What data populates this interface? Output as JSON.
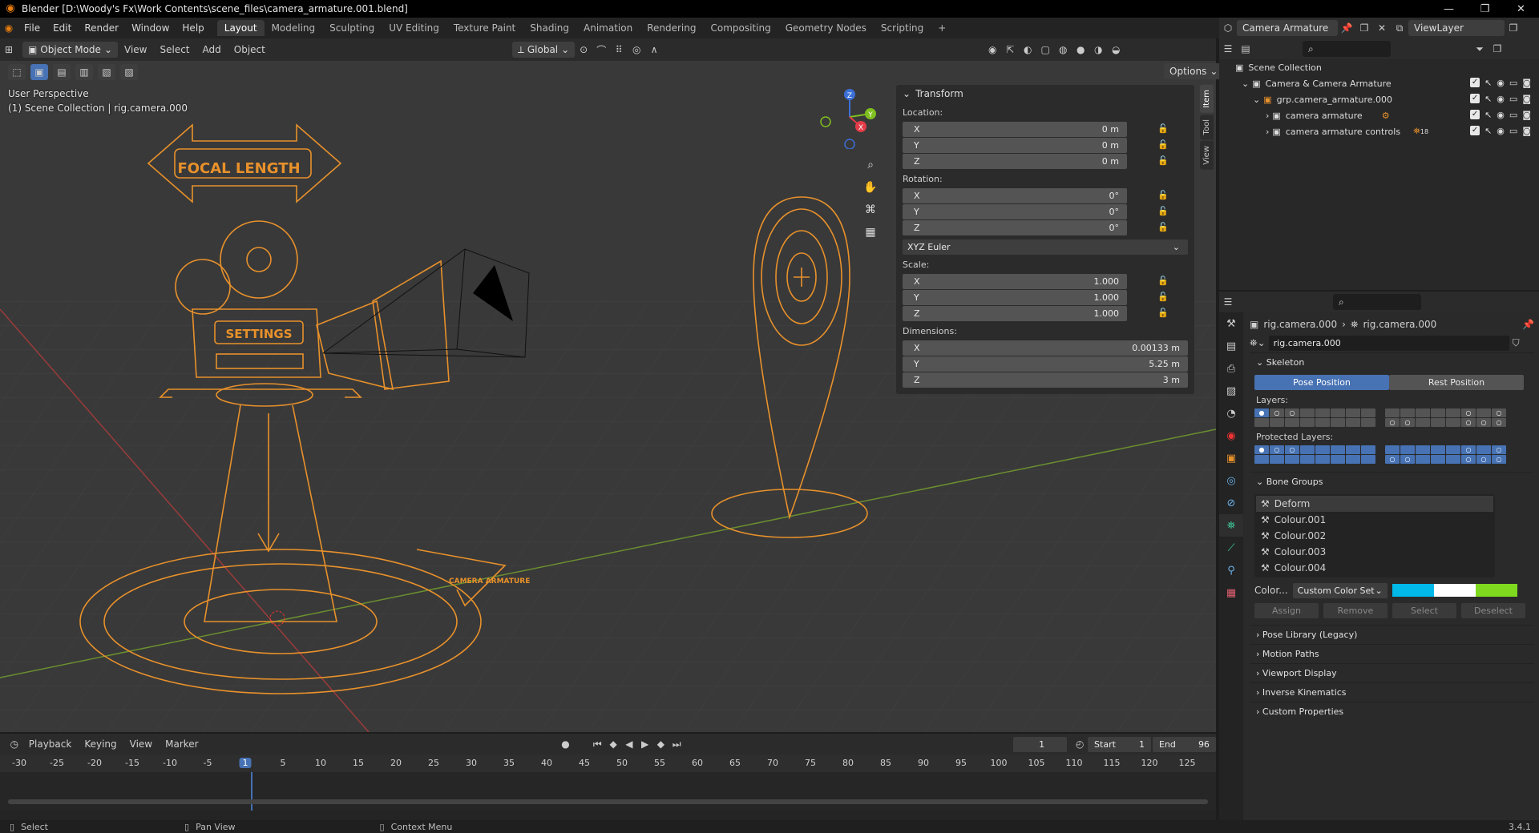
{
  "window": {
    "title": "Blender [D:\\Woody's Fx\\Work Contents\\scene_files\\camera_armature.001.blend]",
    "controls": [
      "—",
      "❐",
      "✕"
    ]
  },
  "menu": [
    "File",
    "Edit",
    "Render",
    "Window",
    "Help"
  ],
  "workspaces": [
    "Layout",
    "Modeling",
    "Sculpting",
    "UV Editing",
    "Texture Paint",
    "Shading",
    "Animation",
    "Rendering",
    "Compositing",
    "Geometry Nodes",
    "Scripting"
  ],
  "active_workspace": "Layout",
  "top_right": {
    "scene_name": "Camera Armature",
    "view_layer": "ViewLayer"
  },
  "viewport_header": {
    "mode": "Object Mode",
    "menus": [
      "View",
      "Select",
      "Add",
      "Object"
    ],
    "orientation": "Global",
    "options": "Options"
  },
  "viewport_overlay_text": {
    "line1": "User Perspective",
    "line2": "(1) Scene Collection | rig.camera.000"
  },
  "gizmo_labels": {
    "z": "Z",
    "y": "Y",
    "x": "X"
  },
  "npanel": {
    "tabs": [
      "Item",
      "Tool",
      "View"
    ],
    "title": "Transform",
    "location_label": "Location:",
    "location": [
      {
        "axis": "X",
        "value": "0 m"
      },
      {
        "axis": "Y",
        "value": "0 m"
      },
      {
        "axis": "Z",
        "value": "0 m"
      }
    ],
    "rotation_label": "Rotation:",
    "rotation": [
      {
        "axis": "X",
        "value": "0°"
      },
      {
        "axis": "Y",
        "value": "0°"
      },
      {
        "axis": "Z",
        "value": "0°"
      }
    ],
    "rotation_mode": "XYZ Euler",
    "scale_label": "Scale:",
    "scale": [
      {
        "axis": "X",
        "value": "1.000"
      },
      {
        "axis": "Y",
        "value": "1.000"
      },
      {
        "axis": "Z",
        "value": "1.000"
      }
    ],
    "dimensions_label": "Dimensions:",
    "dimensions": [
      {
        "axis": "X",
        "value": "0.00133 m"
      },
      {
        "axis": "Y",
        "value": "5.25 m"
      },
      {
        "axis": "Z",
        "value": "3 m"
      }
    ]
  },
  "scene_text": {
    "focal": "FOCAL LENGTH",
    "settings": "SETTINGS",
    "camera": "CAMERA\nARMATURE"
  },
  "timeline": {
    "menus": [
      "Playback",
      "Keying",
      "View",
      "Marker"
    ],
    "current_frame": "1",
    "start_label": "Start",
    "start": "1",
    "end_label": "End",
    "end": "96",
    "ticks": [
      "-30",
      "-25",
      "-20",
      "-15",
      "-10",
      "-5",
      "1",
      "5",
      "10",
      "15",
      "20",
      "25",
      "30",
      "35",
      "40",
      "45",
      "50",
      "55",
      "60",
      "65",
      "70",
      "75",
      "80",
      "85",
      "90",
      "95",
      "100",
      "105",
      "110",
      "115",
      "120",
      "125"
    ]
  },
  "outliner": {
    "root": "Scene Collection",
    "items": [
      {
        "name": "Camera & Camera Armature",
        "depth": 1
      },
      {
        "name": "grp.camera_armature.000",
        "depth": 2
      },
      {
        "name": "camera armature",
        "depth": 3
      },
      {
        "name": "camera armature controls",
        "depth": 3
      }
    ],
    "badge": "18"
  },
  "properties": {
    "breadcrumb_a": "rig.camera.000",
    "breadcrumb_b": "rig.camera.000",
    "datablock": "rig.camera.000",
    "skeleton_title": "Skeleton",
    "pose_position": "Pose Position",
    "rest_position": "Rest Position",
    "layers_label": "Layers:",
    "protected_label": "Protected Layers:",
    "bone_groups_title": "Bone Groups",
    "bone_groups": [
      "Deform",
      "Colour.001",
      "Colour.002",
      "Colour.003",
      "Colour.004"
    ],
    "color_label": "Color...",
    "color_set": "Custom Color Set",
    "swatches": [
      "#00b9e8",
      "#ffffff",
      "#7ed91f"
    ],
    "actions": [
      "Assign",
      "Remove",
      "Select",
      "Deselect"
    ],
    "collapsed_sections": [
      "Pose Library (Legacy)",
      "Motion Paths",
      "Viewport Display",
      "Inverse Kinematics",
      "Custom Properties"
    ]
  },
  "status_bar": {
    "select": "Select",
    "pan": "Pan View",
    "context": "Context Menu",
    "version": "3.4.1"
  }
}
